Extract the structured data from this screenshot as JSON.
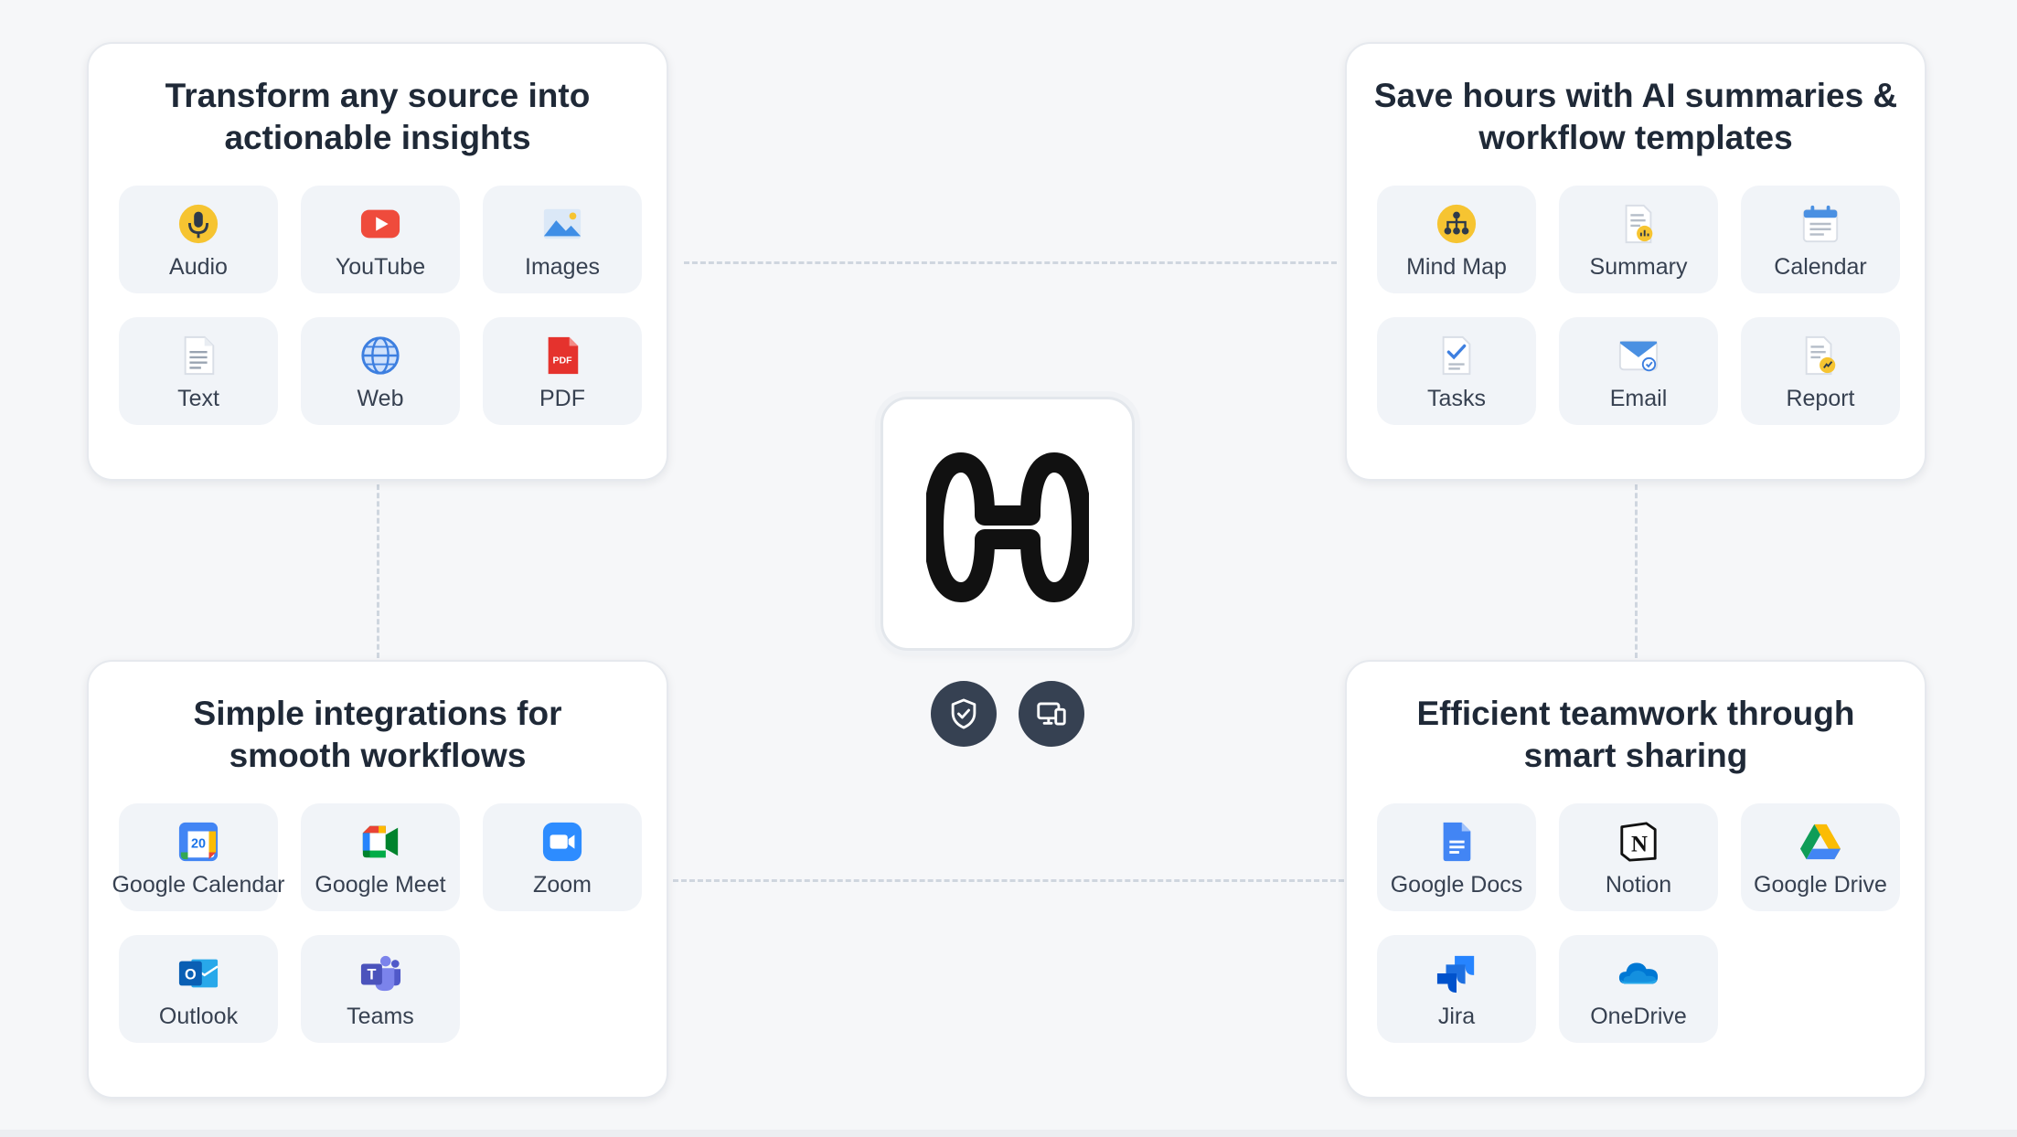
{
  "panels": {
    "sources": {
      "title_line1": "Transform any source into",
      "title_line2": "actionable insights",
      "items": [
        {
          "label": "Audio",
          "icon": "microphone-icon"
        },
        {
          "label": "YouTube",
          "icon": "youtube-icon"
        },
        {
          "label": "Images",
          "icon": "image-icon"
        },
        {
          "label": "Text",
          "icon": "text-document-icon"
        },
        {
          "label": "Web",
          "icon": "globe-icon"
        },
        {
          "label": "PDF",
          "icon": "pdf-icon",
          "badge": "PDF"
        }
      ]
    },
    "templates": {
      "title_line1": "Save hours with AI summaries &",
      "title_line2": "workflow templates",
      "items": [
        {
          "label": "Mind Map",
          "icon": "mind-map-icon"
        },
        {
          "label": "Summary",
          "icon": "summary-icon"
        },
        {
          "label": "Calendar",
          "icon": "calendar-icon"
        },
        {
          "label": "Tasks",
          "icon": "tasks-icon"
        },
        {
          "label": "Email",
          "icon": "email-icon"
        },
        {
          "label": "Report",
          "icon": "report-icon"
        }
      ]
    },
    "integrations": {
      "title_line1": "Simple integrations for",
      "title_line2": "smooth workflows",
      "items": [
        {
          "label": "Google Calendar",
          "icon": "google-calendar-icon",
          "badge": "20"
        },
        {
          "label": "Google Meet",
          "icon": "google-meet-icon"
        },
        {
          "label": "Zoom",
          "icon": "zoom-icon"
        },
        {
          "label": "Outlook",
          "icon": "outlook-icon",
          "badge": "O"
        },
        {
          "label": "Teams",
          "icon": "teams-icon",
          "badge": "T"
        }
      ]
    },
    "sharing": {
      "title_line1": "Efficient teamwork through",
      "title_line2": "smart sharing",
      "items": [
        {
          "label": "Google Docs",
          "icon": "google-docs-icon"
        },
        {
          "label": "Notion",
          "icon": "notion-icon",
          "badge": "N"
        },
        {
          "label": "Google Drive",
          "icon": "google-drive-icon"
        },
        {
          "label": "Jira",
          "icon": "jira-icon"
        },
        {
          "label": "OneDrive",
          "icon": "onedrive-icon"
        }
      ]
    }
  },
  "center": {
    "logo": "brand-logo-icon",
    "buttons": [
      {
        "icon": "shield-check-icon"
      },
      {
        "icon": "devices-icon"
      }
    ]
  },
  "colors": {
    "background": "#f6f7f9",
    "tile": "#f1f4f8",
    "connector": "#cfd6df",
    "button": "#364152"
  }
}
